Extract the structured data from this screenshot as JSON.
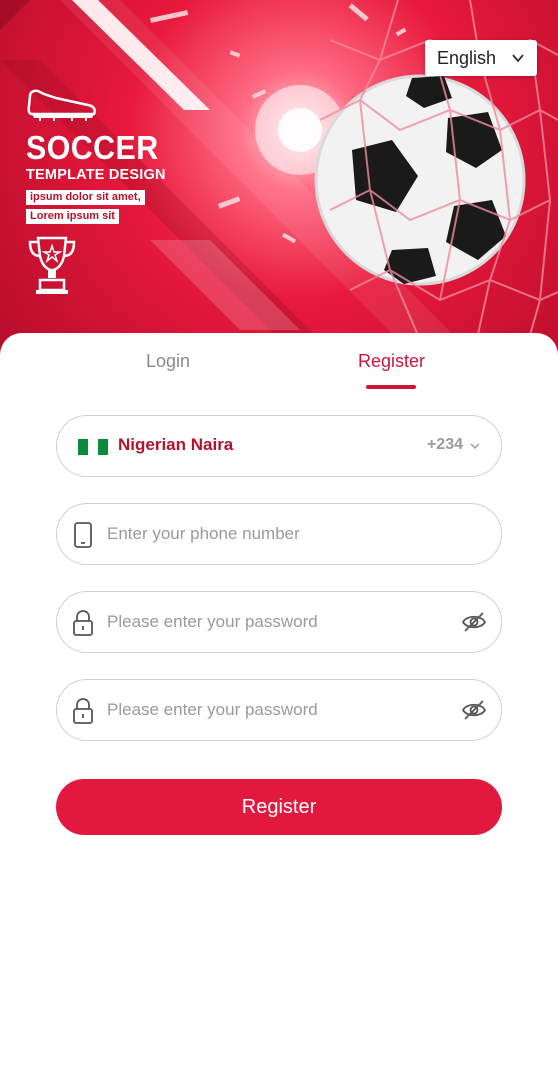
{
  "language": {
    "selected": "English"
  },
  "banner": {
    "title": "SOCCER",
    "subtitle": "TEMPLATE DESIGN",
    "tag1": "ipsum dolor sit amet,",
    "tag2": "Lorem ipsum sit"
  },
  "tabs": [
    {
      "label": "Login",
      "active": false
    },
    {
      "label": "Register",
      "active": true
    }
  ],
  "form": {
    "currency": {
      "name": "Nigerian Naira",
      "dial_code": "+234",
      "flag_icon": "nigeria-flag-icon"
    },
    "phone": {
      "placeholder": "Enter your phone number",
      "icon": "phone-icon"
    },
    "password": {
      "placeholder": "Please enter your password",
      "icon": "lock-icon",
      "toggle_icon": "eye-off-icon"
    },
    "confirm_password": {
      "placeholder": "Please enter your password",
      "icon": "lock-icon",
      "toggle_icon": "eye-off-icon"
    },
    "submit_label": "Register"
  },
  "colors": {
    "accent": "#c8163d",
    "button": "#e2183f",
    "banner": "#e8193c"
  }
}
